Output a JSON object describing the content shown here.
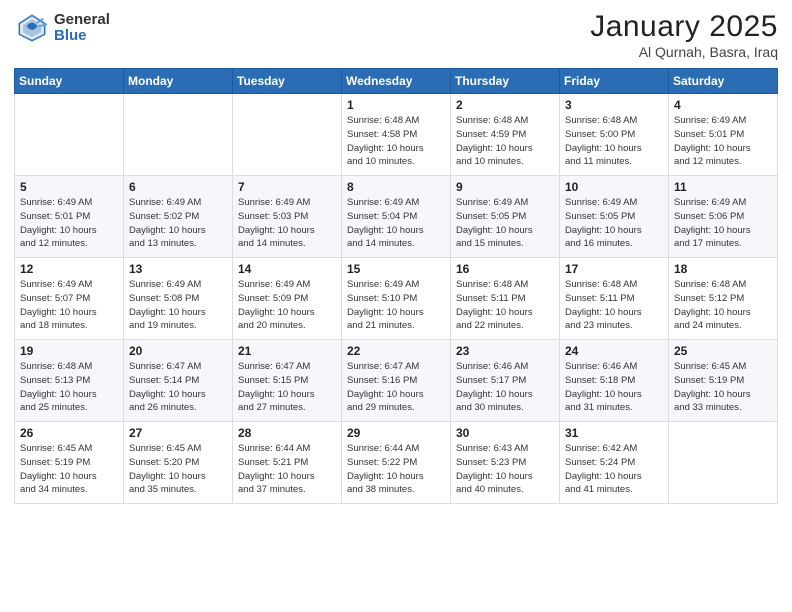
{
  "header": {
    "logo_general": "General",
    "logo_blue": "Blue",
    "title": "January 2025",
    "location": "Al Qurnah, Basra, Iraq"
  },
  "weekdays": [
    "Sunday",
    "Monday",
    "Tuesday",
    "Wednesday",
    "Thursday",
    "Friday",
    "Saturday"
  ],
  "weeks": [
    [
      {
        "day": "",
        "info": ""
      },
      {
        "day": "",
        "info": ""
      },
      {
        "day": "",
        "info": ""
      },
      {
        "day": "1",
        "info": "Sunrise: 6:48 AM\nSunset: 4:58 PM\nDaylight: 10 hours\nand 10 minutes."
      },
      {
        "day": "2",
        "info": "Sunrise: 6:48 AM\nSunset: 4:59 PM\nDaylight: 10 hours\nand 10 minutes."
      },
      {
        "day": "3",
        "info": "Sunrise: 6:48 AM\nSunset: 5:00 PM\nDaylight: 10 hours\nand 11 minutes."
      },
      {
        "day": "4",
        "info": "Sunrise: 6:49 AM\nSunset: 5:01 PM\nDaylight: 10 hours\nand 12 minutes."
      }
    ],
    [
      {
        "day": "5",
        "info": "Sunrise: 6:49 AM\nSunset: 5:01 PM\nDaylight: 10 hours\nand 12 minutes."
      },
      {
        "day": "6",
        "info": "Sunrise: 6:49 AM\nSunset: 5:02 PM\nDaylight: 10 hours\nand 13 minutes."
      },
      {
        "day": "7",
        "info": "Sunrise: 6:49 AM\nSunset: 5:03 PM\nDaylight: 10 hours\nand 14 minutes."
      },
      {
        "day": "8",
        "info": "Sunrise: 6:49 AM\nSunset: 5:04 PM\nDaylight: 10 hours\nand 14 minutes."
      },
      {
        "day": "9",
        "info": "Sunrise: 6:49 AM\nSunset: 5:05 PM\nDaylight: 10 hours\nand 15 minutes."
      },
      {
        "day": "10",
        "info": "Sunrise: 6:49 AM\nSunset: 5:05 PM\nDaylight: 10 hours\nand 16 minutes."
      },
      {
        "day": "11",
        "info": "Sunrise: 6:49 AM\nSunset: 5:06 PM\nDaylight: 10 hours\nand 17 minutes."
      }
    ],
    [
      {
        "day": "12",
        "info": "Sunrise: 6:49 AM\nSunset: 5:07 PM\nDaylight: 10 hours\nand 18 minutes."
      },
      {
        "day": "13",
        "info": "Sunrise: 6:49 AM\nSunset: 5:08 PM\nDaylight: 10 hours\nand 19 minutes."
      },
      {
        "day": "14",
        "info": "Sunrise: 6:49 AM\nSunset: 5:09 PM\nDaylight: 10 hours\nand 20 minutes."
      },
      {
        "day": "15",
        "info": "Sunrise: 6:49 AM\nSunset: 5:10 PM\nDaylight: 10 hours\nand 21 minutes."
      },
      {
        "day": "16",
        "info": "Sunrise: 6:48 AM\nSunset: 5:11 PM\nDaylight: 10 hours\nand 22 minutes."
      },
      {
        "day": "17",
        "info": "Sunrise: 6:48 AM\nSunset: 5:11 PM\nDaylight: 10 hours\nand 23 minutes."
      },
      {
        "day": "18",
        "info": "Sunrise: 6:48 AM\nSunset: 5:12 PM\nDaylight: 10 hours\nand 24 minutes."
      }
    ],
    [
      {
        "day": "19",
        "info": "Sunrise: 6:48 AM\nSunset: 5:13 PM\nDaylight: 10 hours\nand 25 minutes."
      },
      {
        "day": "20",
        "info": "Sunrise: 6:47 AM\nSunset: 5:14 PM\nDaylight: 10 hours\nand 26 minutes."
      },
      {
        "day": "21",
        "info": "Sunrise: 6:47 AM\nSunset: 5:15 PM\nDaylight: 10 hours\nand 27 minutes."
      },
      {
        "day": "22",
        "info": "Sunrise: 6:47 AM\nSunset: 5:16 PM\nDaylight: 10 hours\nand 29 minutes."
      },
      {
        "day": "23",
        "info": "Sunrise: 6:46 AM\nSunset: 5:17 PM\nDaylight: 10 hours\nand 30 minutes."
      },
      {
        "day": "24",
        "info": "Sunrise: 6:46 AM\nSunset: 5:18 PM\nDaylight: 10 hours\nand 31 minutes."
      },
      {
        "day": "25",
        "info": "Sunrise: 6:45 AM\nSunset: 5:19 PM\nDaylight: 10 hours\nand 33 minutes."
      }
    ],
    [
      {
        "day": "26",
        "info": "Sunrise: 6:45 AM\nSunset: 5:19 PM\nDaylight: 10 hours\nand 34 minutes."
      },
      {
        "day": "27",
        "info": "Sunrise: 6:45 AM\nSunset: 5:20 PM\nDaylight: 10 hours\nand 35 minutes."
      },
      {
        "day": "28",
        "info": "Sunrise: 6:44 AM\nSunset: 5:21 PM\nDaylight: 10 hours\nand 37 minutes."
      },
      {
        "day": "29",
        "info": "Sunrise: 6:44 AM\nSunset: 5:22 PM\nDaylight: 10 hours\nand 38 minutes."
      },
      {
        "day": "30",
        "info": "Sunrise: 6:43 AM\nSunset: 5:23 PM\nDaylight: 10 hours\nand 40 minutes."
      },
      {
        "day": "31",
        "info": "Sunrise: 6:42 AM\nSunset: 5:24 PM\nDaylight: 10 hours\nand 41 minutes."
      },
      {
        "day": "",
        "info": ""
      }
    ]
  ]
}
